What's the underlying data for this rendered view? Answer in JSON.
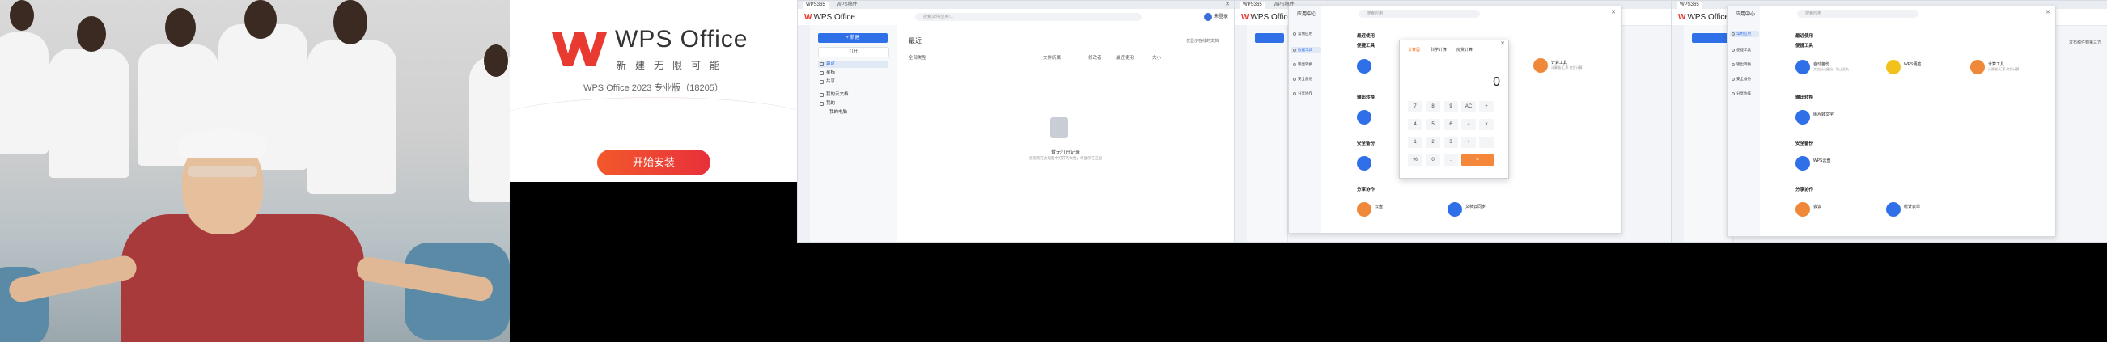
{
  "installer": {
    "brand": "WPS Office",
    "tagline": "新建无限可能",
    "version": "WPS Office 2023 专业版（18205）",
    "install_button": "开始安装",
    "colors": {
      "accent": "#f2592c",
      "logo_red": "#e83a30"
    }
  },
  "wps_home": {
    "tabs": [
      "WPS365",
      "WPS稿件"
    ],
    "logo": "WPS Office",
    "search_placeholder": "搜索文件/应用/...",
    "account": "未登录",
    "new_button": "+ 新建",
    "open_button": "打开",
    "nav": [
      "最近",
      "星标",
      "共享",
      "我的云文档",
      "我的",
      "我的电脑"
    ],
    "section_title": "最近",
    "columns": [
      "全部类型",
      "文件所属",
      "修改者",
      "最近使用",
      "大小"
    ],
    "empty_title": "暂无打开记录",
    "empty_desc": "您近期在此电脑中打开的文档，将显示在这里",
    "filter_label": "仅显示在线的文档"
  },
  "app_center_calc": {
    "tabs": [
      "WPS365",
      "WPS稿件"
    ],
    "logo": "WPS Office",
    "title": "应用中心",
    "search_placeholder": "搜索应用",
    "side_items": [
      "常用应用",
      "数据工具",
      "输出转换",
      "安全备份",
      "分享协作"
    ],
    "section_recent": "最近使用",
    "section_convenient": "便捷工具",
    "section_output": "输出转换",
    "section_security": "安全备份",
    "section_share": "分享协作",
    "calc": {
      "tabs": [
        "计算器",
        "科学计算",
        "房贷计算"
      ],
      "display": "0",
      "keys": [
        "7",
        "8",
        "9",
        "AC",
        "÷",
        "4",
        "5",
        "6",
        "−",
        "×",
        "1",
        "2",
        "3",
        "+",
        "",
        "%",
        "0",
        ".",
        "="
      ]
    },
    "tools": [
      {
        "name": "计算工具",
        "desc": "计算器·汇率·房贷计算"
      },
      {
        "name": "云盘",
        "desc": ""
      },
      {
        "name": "文档云同步",
        "desc": ""
      }
    ]
  },
  "app_center_full": {
    "tabs": [
      "WPS365"
    ],
    "logo": "WPS Office",
    "title": "应用中心",
    "search_placeholder": "搜索应用",
    "side_items": [
      "常用应用",
      "便捷工具",
      "输出转换",
      "安全备份",
      "分享协作"
    ],
    "section_recent": "最近使用",
    "section_convenient": "便捷工具",
    "section_output": "输出转换",
    "section_security": "安全备份",
    "section_share": "分享协作",
    "tools_convenient": [
      {
        "name": "自动备份",
        "desc": "文档自动备份，防止丢失"
      },
      {
        "name": "WPS便签",
        "desc": ""
      },
      {
        "name": "计算工具",
        "desc": "计算器·汇率·房贷计算"
      }
    ],
    "tools_output": [
      {
        "name": "图片转文字",
        "desc": ""
      }
    ],
    "tools_security": [
      {
        "name": "WPS云盘",
        "desc": ""
      }
    ],
    "tools_share": [
      {
        "name": "会议",
        "desc": ""
      },
      {
        "name": "统计表单",
        "desc": ""
      }
    ],
    "side_note": "发布稿件到第三方"
  }
}
